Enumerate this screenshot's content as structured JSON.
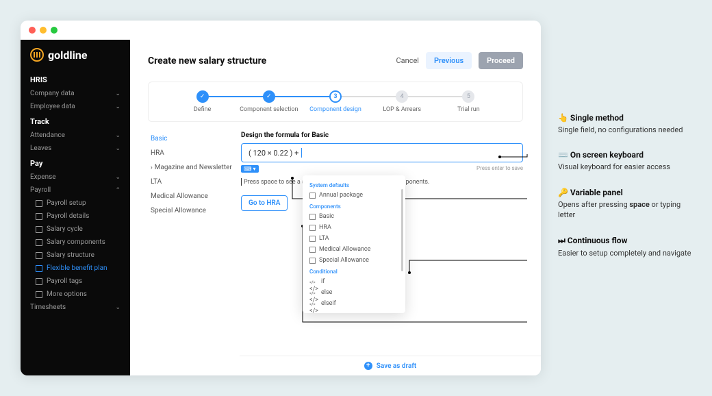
{
  "brand": "goldline",
  "sidebar": {
    "sections": [
      {
        "label": "HRIS",
        "items": [
          {
            "label": "Company data"
          },
          {
            "label": "Employee data"
          }
        ]
      },
      {
        "label": "Track",
        "items": [
          {
            "label": "Attendance"
          },
          {
            "label": "Leaves"
          }
        ]
      },
      {
        "label": "Pay",
        "items": [
          {
            "label": "Expense"
          },
          {
            "label": "Payroll",
            "expanded": true,
            "children": [
              {
                "label": "Payroll setup"
              },
              {
                "label": "Payroll details"
              },
              {
                "label": "Salary cycle"
              },
              {
                "label": "Salary components"
              },
              {
                "label": "Salary structure"
              },
              {
                "label": "Flexible benefit plan",
                "active": true
              },
              {
                "label": "Payroll tags"
              },
              {
                "label": "More options"
              }
            ]
          },
          {
            "label": "Timesheets"
          }
        ]
      }
    ]
  },
  "header": {
    "title": "Create new salary structure",
    "cancel": "Cancel",
    "previous": "Previous",
    "proceed": "Proceed"
  },
  "stepper": [
    {
      "label": "Define",
      "state": "done"
    },
    {
      "label": "Component selection",
      "state": "done"
    },
    {
      "label": "Component design",
      "state": "current",
      "num": "3"
    },
    {
      "label": "LOP & Arrears",
      "state": "pending",
      "num": "4"
    },
    {
      "label": "Trial run",
      "state": "pending",
      "num": "5"
    }
  ],
  "components": [
    {
      "label": "Basic",
      "active": true
    },
    {
      "label": "HRA"
    },
    {
      "label": "Magazine and Newsletter",
      "nested": true
    },
    {
      "label": "LTA"
    },
    {
      "label": "Medical Allowance"
    },
    {
      "label": "Special Allowance"
    }
  ],
  "designer": {
    "title": "Design the formula for Basic",
    "formula": "( 120 × 0.22 ) + ",
    "kbd_hint": "⌨ ▾",
    "enter_hint": "Press enter to save",
    "help_text": "Press space to see a suggestions list of operators and components.",
    "go_label": "Go to HRA"
  },
  "dropdown": {
    "sections": [
      {
        "label": "System defaults",
        "items": [
          {
            "label": "Annual package"
          }
        ]
      },
      {
        "label": "Components",
        "items": [
          {
            "label": "Basic"
          },
          {
            "label": "HRA"
          },
          {
            "label": "LTA"
          },
          {
            "label": "Medical Allowance"
          },
          {
            "label": "Special Allowance"
          }
        ]
      },
      {
        "label": "Conditional",
        "items": [
          {
            "label": "if",
            "code": true
          },
          {
            "label": "else",
            "code": true
          },
          {
            "label": "elseif",
            "code": true
          }
        ]
      }
    ]
  },
  "footer": {
    "save": "Save as draft"
  },
  "callouts": [
    {
      "emoji": "👆",
      "title": "Single method",
      "desc": "Single field, no configurations needed"
    },
    {
      "emoji": "⌨️",
      "title": "On screen keyboard",
      "desc": "Visual keyboard for easier access"
    },
    {
      "emoji": "🔑",
      "title": "Variable panel",
      "desc_pre": "Opens after pressing ",
      "desc_bold": "space",
      "desc_post": " or typing letter"
    },
    {
      "emoji": "⏭",
      "title": "Continuous flow",
      "desc": "Easier to setup completely and navigate"
    }
  ]
}
